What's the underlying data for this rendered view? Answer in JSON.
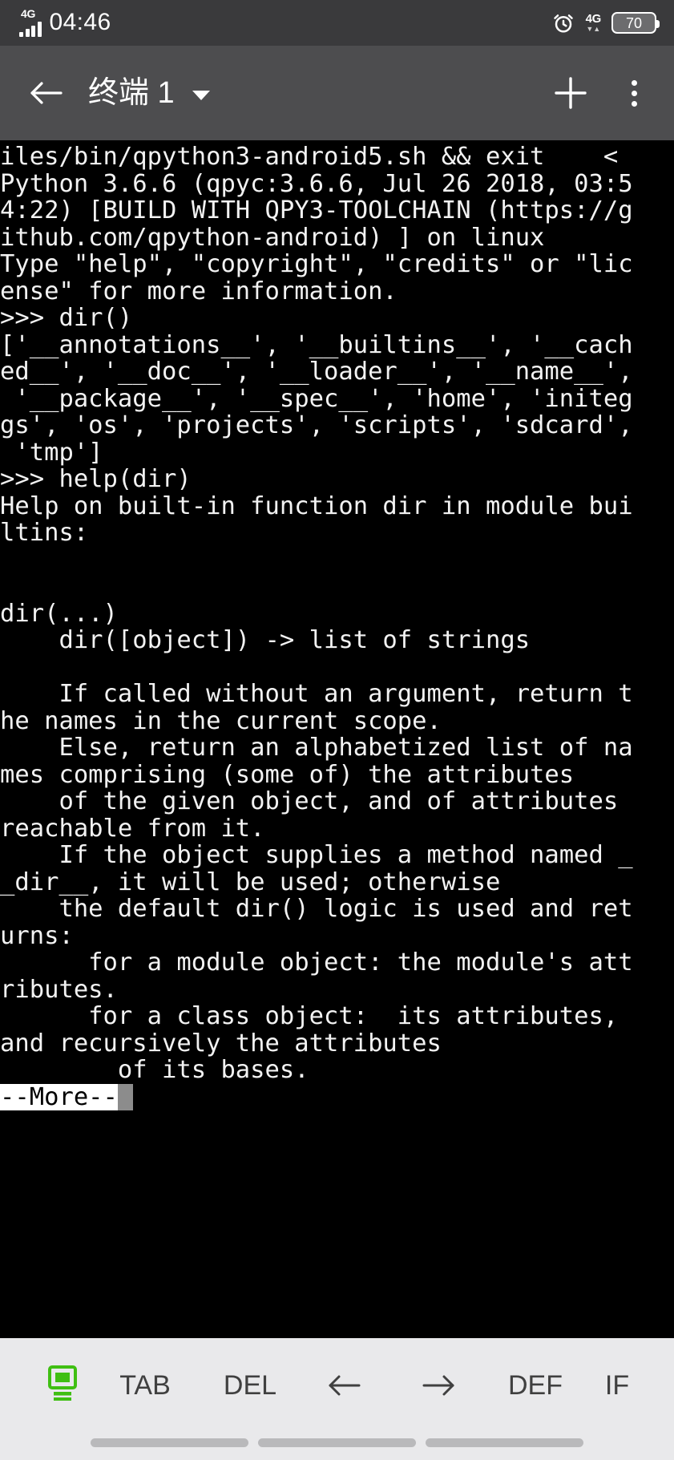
{
  "status_bar": {
    "network_label": "4G",
    "time": "04:46",
    "alarm_icon": "alarm-clock-icon",
    "data_network_label": "4G",
    "data_arrows": "▼▲",
    "battery_percent": "70"
  },
  "app_bar": {
    "back_icon": "arrow-left-icon",
    "title": "终端 1",
    "dropdown_icon": "chevron-down-icon",
    "add_icon": "plus-icon",
    "overflow_icon": "more-vertical-icon"
  },
  "terminal": {
    "lines": [
      "iles/bin/qpython3-android5.sh && exit    <",
      "Python 3.6.6 (qpyc:3.6.6, Jul 26 2018, 03:5",
      "4:22) [BUILD WITH QPY3-TOOLCHAIN (https://g",
      "ithub.com/qpython-android) ] on linux",
      "Type \"help\", \"copyright\", \"credits\" or \"lic",
      "ense\" for more information.",
      ">>> dir()",
      "['__annotations__', '__builtins__', '__cach",
      "ed__', '__doc__', '__loader__', '__name__',",
      " '__package__', '__spec__', 'home', 'initeg",
      "gs', 'os', 'projects', 'scripts', 'sdcard',",
      " 'tmp']",
      ">>> help(dir)",
      "Help on built-in function dir in module bui",
      "ltins:",
      "",
      "",
      "dir(...)",
      "    dir([object]) -> list of strings",
      "",
      "    If called without an argument, return t",
      "he names in the current scope.",
      "    Else, return an alphabetized list of na",
      "mes comprising (some of) the attributes",
      "    of the given object, and of attributes",
      "reachable from it.",
      "    If the object supplies a method named _",
      "_dir__, it will be used; otherwise",
      "    the default dir() logic is used and ret",
      "urns:",
      "      for a module object: the module's att",
      "ributes.",
      "      for a class object:  its attributes,",
      "and recursively the attributes",
      "        of its bases."
    ],
    "pager_prompt": "--More--",
    "cursor": "block-cursor",
    "foreground_color": "#f2f2f2",
    "background_color": "#000000"
  },
  "key_toolbar": {
    "terminal_toggle_icon": "terminal-monitor-icon",
    "terminal_toggle_color": "#3fbf12",
    "keys": [
      {
        "label": "TAB",
        "name": "key-tab"
      },
      {
        "label": "DEL",
        "name": "key-del"
      },
      {
        "label": "←",
        "name": "key-arrow-left"
      },
      {
        "label": "→",
        "name": "key-arrow-right"
      },
      {
        "label": "DEF",
        "name": "key-def"
      },
      {
        "label": "IF",
        "name": "key-if"
      }
    ]
  },
  "nav_bar": {
    "hint_pills": 3
  }
}
